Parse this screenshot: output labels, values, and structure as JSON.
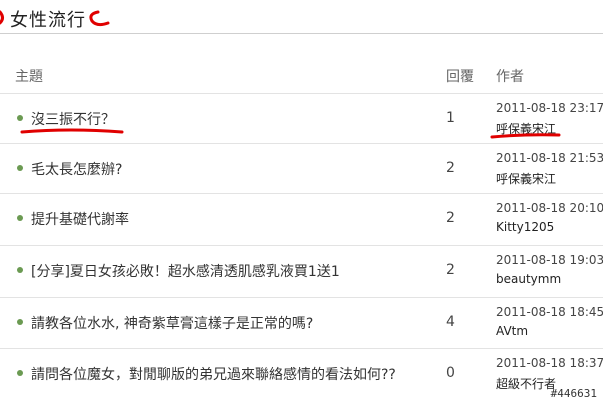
{
  "board": {
    "title": "女性流行"
  },
  "columns": {
    "subject": "主題",
    "replies": "回覆",
    "author": "作者"
  },
  "topics": [
    {
      "subject": "沒三振不行？",
      "replies": "1",
      "date": "2011-08-18 23:17",
      "author": "呼保義宋江"
    },
    {
      "subject": "毛太長怎麼辦?",
      "replies": "2",
      "date": "2011-08-18 21:53",
      "author": "呼保義宋江"
    },
    {
      "subject": "提升基礎代謝率",
      "replies": "2",
      "date": "2011-08-18 20:10",
      "author": "Kitty1205"
    },
    {
      "subject": "[分享]夏日女孩必敗！超水感清透肌感乳液買1送1",
      "replies": "2",
      "date": "2011-08-18 19:03",
      "author": "beautymm"
    },
    {
      "subject": "請教各位水水, 神奇紫草膏這樣子是正常的嗎?",
      "replies": "4",
      "date": "2011-08-18 18:45",
      "author": "AVtm"
    },
    {
      "subject": "請問各位魔女，對閒聊版的弟兄過來聯絡感情的看法如何??",
      "replies": "0",
      "date": "2011-08-18 18:37",
      "author": "超級不行者"
    }
  ],
  "watermark": "#446631",
  "annotation_color": "#e00000",
  "bullet_color": "#6b9a52"
}
